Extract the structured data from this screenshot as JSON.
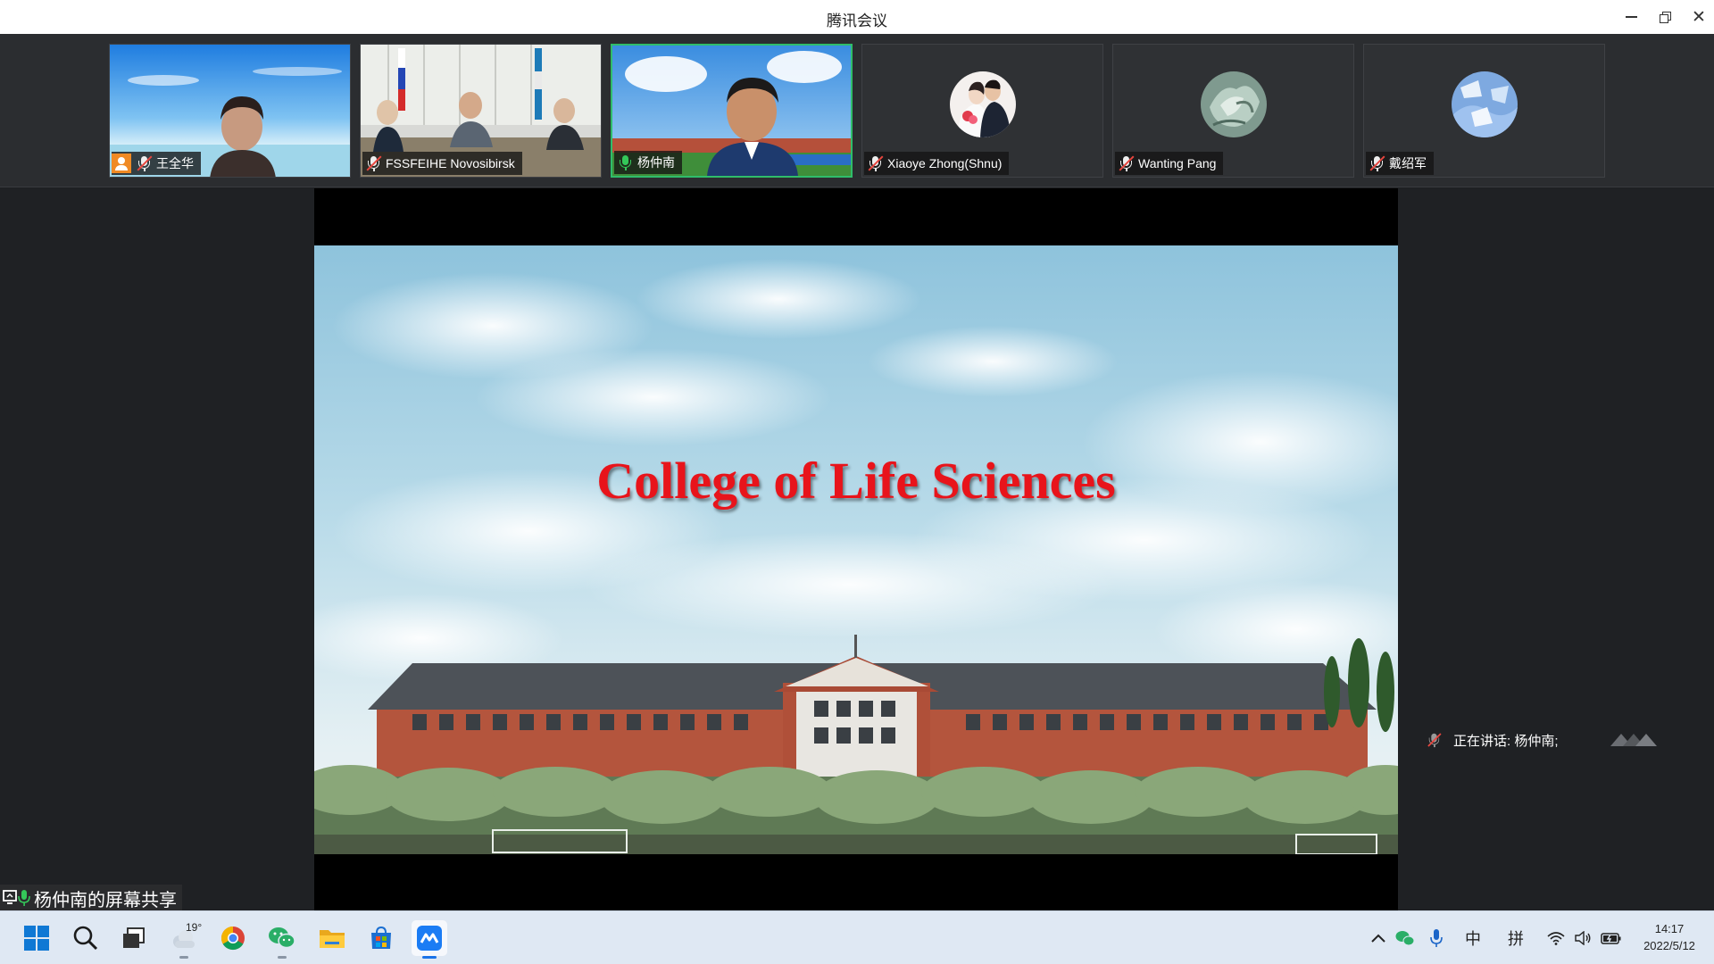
{
  "window": {
    "title": "腾讯会议",
    "controls": {
      "minimize": "minimize-icon",
      "restore": "restore-icon",
      "close": "close-icon"
    }
  },
  "participants": [
    {
      "name": "王全华",
      "mic": "muted",
      "host": true,
      "video": "camera"
    },
    {
      "name": "FSSFEIHE Novosibirsk",
      "mic": "muted",
      "host": false,
      "video": "camera"
    },
    {
      "name": "杨仲南",
      "mic": "active",
      "host": false,
      "video": "camera",
      "speaking": true
    },
    {
      "name": "Xiaoye Zhong(Shnu)",
      "mic": "muted",
      "host": false,
      "video": "avatar"
    },
    {
      "name": "Wanting Pang",
      "mic": "muted",
      "host": false,
      "video": "avatar"
    },
    {
      "name": "戴绍军",
      "mic": "muted",
      "host": false,
      "video": "avatar"
    }
  ],
  "slide": {
    "title": "College of Life Sciences"
  },
  "speaking_indicator": {
    "label": "正在讲话: 杨仲南;"
  },
  "share": {
    "label": "杨仲南的屏幕共享"
  },
  "taskbar": {
    "apps": [
      "start-icon",
      "search-icon",
      "task-view-icon",
      "weather-widget",
      "chrome-icon",
      "wechat-icon",
      "file-explorer-icon",
      "store-icon",
      "tencent-meeting-icon"
    ],
    "weather_temp": "19°",
    "ime_lang": "中",
    "ime_mode": "拼",
    "time": "14:17",
    "date": "2022/5/12"
  },
  "colors": {
    "speaking_border": "#2fbd6a",
    "muted_mic": "#e8463f",
    "slide_title": "#e8141b",
    "host_badge": "#f08a24"
  }
}
